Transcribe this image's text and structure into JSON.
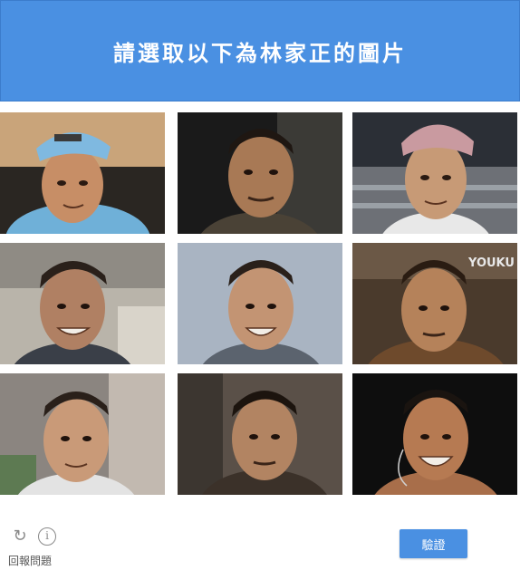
{
  "header": {
    "title": "請選取以下為林家正的圖片"
  },
  "tiles": [
    {
      "desc": "man-blue-cap"
    },
    {
      "desc": "man-dark-stubble"
    },
    {
      "desc": "man-baseball-cap-stadium"
    },
    {
      "desc": "man-smiling-indoor"
    },
    {
      "desc": "man-smiling-grey-bg"
    },
    {
      "desc": "man-film-still",
      "watermark": "YOUKU"
    },
    {
      "desc": "man-short-hair"
    },
    {
      "desc": "man-film-still-crowd"
    },
    {
      "desc": "man-smiling-mic"
    }
  ],
  "footer": {
    "report_label": "回報問題",
    "verify_label": "驗證",
    "reload_icon": "reload-icon",
    "info_icon": "info-icon"
  },
  "colors": {
    "accent": "#4a90e2"
  }
}
